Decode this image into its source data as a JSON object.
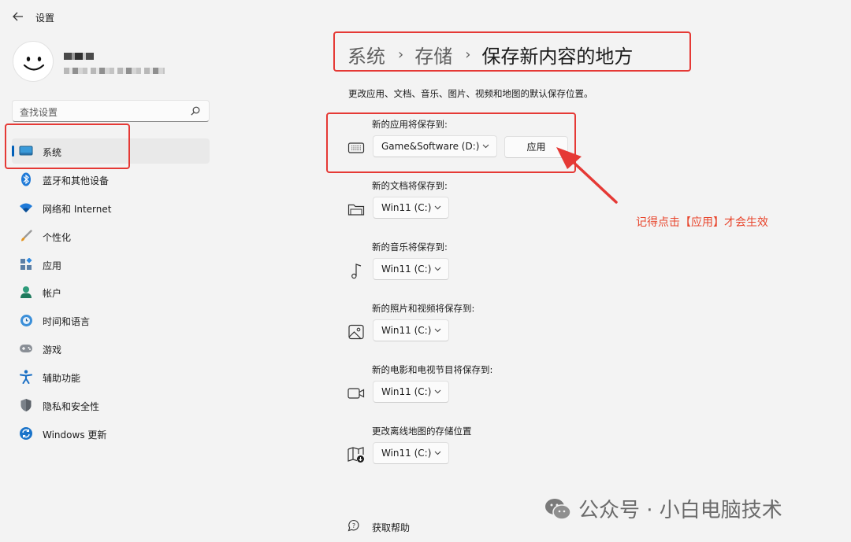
{
  "window": {
    "title": "设置"
  },
  "profile": {},
  "search": {
    "placeholder": "查找设置"
  },
  "sidebar": {
    "items": [
      {
        "label": "系统"
      },
      {
        "label": "蓝牙和其他设备"
      },
      {
        "label": "网络和 Internet"
      },
      {
        "label": "个性化"
      },
      {
        "label": "应用"
      },
      {
        "label": "帐户"
      },
      {
        "label": "时间和语言"
      },
      {
        "label": "游戏"
      },
      {
        "label": "辅助功能"
      },
      {
        "label": "隐私和安全性"
      },
      {
        "label": "Windows 更新"
      }
    ]
  },
  "breadcrumb": {
    "items": [
      "系统",
      "存储",
      "保存新内容的地方"
    ],
    "separator": "›"
  },
  "main": {
    "description": "更改应用、文档、音乐、图片、视频和地图的默认保存位置。",
    "sections": [
      {
        "label": "新的应用将保存到:",
        "value": "Game&Software (D:)",
        "icon": "drive-icon"
      },
      {
        "label": "新的文档将保存到:",
        "value": "Win11 (C:)",
        "icon": "folder-icon"
      },
      {
        "label": "新的音乐将保存到:",
        "value": "Win11 (C:)",
        "icon": "music-note-icon"
      },
      {
        "label": "新的照片和视频将保存到:",
        "value": "Win11 (C:)",
        "icon": "image-icon"
      },
      {
        "label": "新的电影和电视节目将保存到:",
        "value": "Win11 (C:)",
        "icon": "video-camera-icon"
      },
      {
        "label": "更改离线地图的存储位置",
        "value": "Win11 (C:)",
        "icon": "map-download-icon"
      }
    ],
    "apply_label": "应用"
  },
  "annotation": {
    "text": "记得点击【应用】才会生效",
    "color": "#e8452c"
  },
  "help": {
    "label": "获取帮助"
  },
  "watermark": {
    "text": "公众号 · 小白电脑技术"
  },
  "colors": {
    "accent": "#005fb8",
    "annotation_red": "#e53935",
    "background": "#f3f3f3"
  }
}
